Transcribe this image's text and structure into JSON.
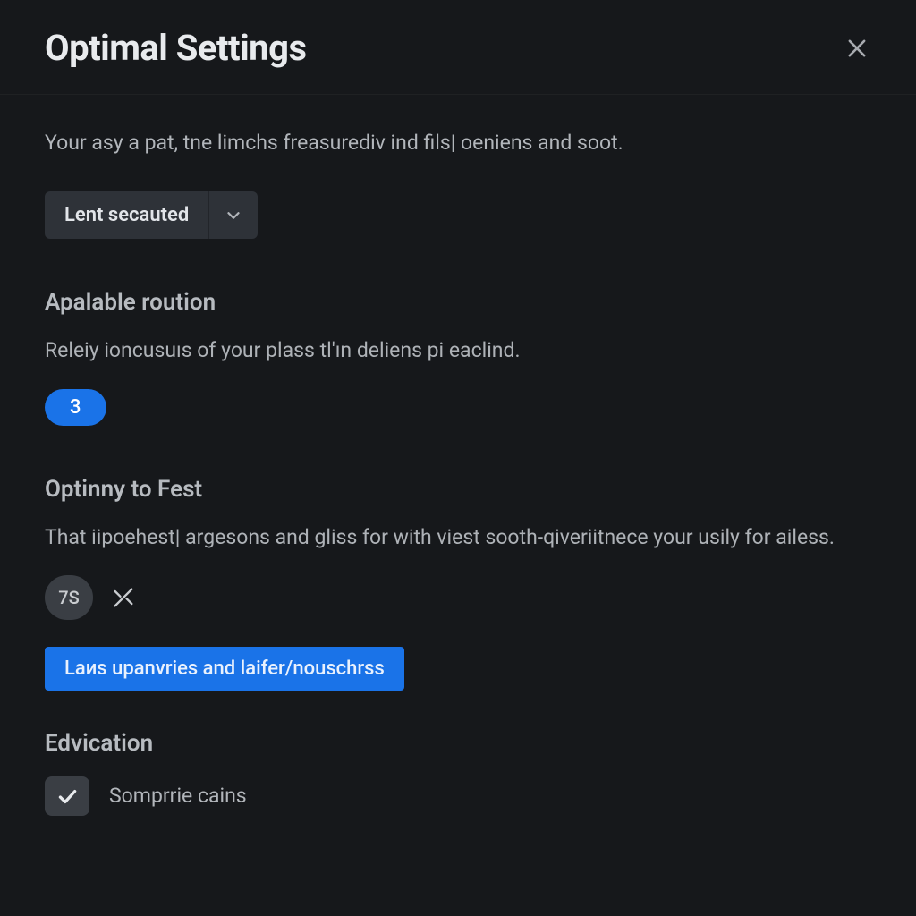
{
  "header": {
    "title": "Optimal Settings"
  },
  "intro": "Your asy a pat, tne limchs freasurediv ind fils| oeniens and soot.",
  "dropdown": {
    "selected": "Lent secauted"
  },
  "section1": {
    "title": "Apalable roution",
    "desc": "Releiy ioncusuıs of your plass tl'ın deliens pi eaclind.",
    "pill": "3"
  },
  "section2": {
    "title": "Optinny to Fest",
    "desc": "That iipoehest| argesons and gliss for with viest sooth-qiveriitnece your usily for ailess.",
    "chip": "7S",
    "button": "Laиs upanvries and laifer/nouschrss"
  },
  "section3": {
    "title": "Edvication",
    "checkbox_label": "Somprrie cains"
  }
}
